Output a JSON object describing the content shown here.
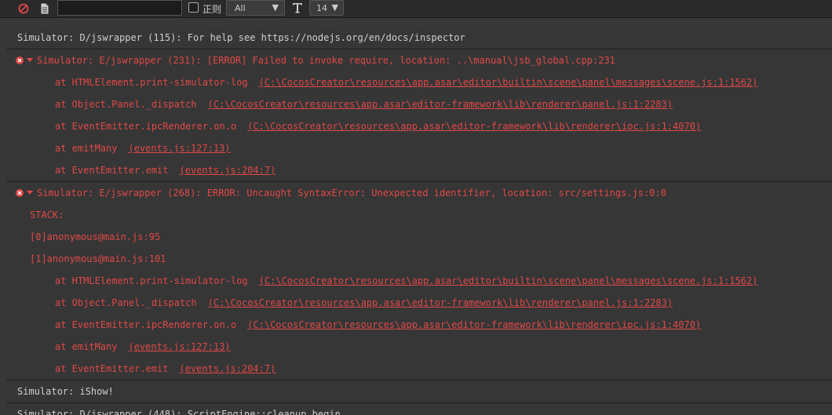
{
  "toolbar": {
    "search_value": "",
    "regex_label": "正则",
    "level_value": "All",
    "font_size_value": "14"
  },
  "colors": {
    "error": "#e04848",
    "text": "#cfcfcf",
    "background": "#383838"
  },
  "log": {
    "entry1": "Simulator: D/jswrapper (115): For help see https://nodejs.org/en/docs/inspector",
    "entry2": {
      "head": "Simulator: E/jswrapper (231): [ERROR] Failed to invoke require, location: ..\\manual\\jsb_global.cpp:231",
      "stack": [
        {
          "fn": "at HTMLElement.print-simulator-log",
          "src": "(C:\\CocosCreator\\resources\\app.asar\\editor\\builtin\\scene\\panel\\messages\\scene.js:1:1562)"
        },
        {
          "fn": "at Object.Panel._dispatch",
          "src": "(C:\\CocosCreator\\resources\\app.asar\\editor-framework\\lib\\renderer\\panel.js:1:2283)"
        },
        {
          "fn": "at EventEmitter.ipcRenderer.on.o",
          "src": "(C:\\CocosCreator\\resources\\app.asar\\editor-framework\\lib\\renderer\\ipc.js:1:4070)"
        },
        {
          "fn": "at emitMany",
          "src": "(events.js:127:13)"
        },
        {
          "fn": "at EventEmitter.emit",
          "src": "(events.js:204:7)"
        }
      ]
    },
    "entry3": {
      "head": "Simulator: E/jswrapper (268): ERROR: Uncaught SyntaxError: Unexpected identifier, location: src/settings.js:0:0",
      "lines": [
        "STACK:",
        "[0]anonymous@main.js:95",
        "[1]anonymous@main.js:101"
      ],
      "stack": [
        {
          "fn": "at HTMLElement.print-simulator-log",
          "src": "(C:\\CocosCreator\\resources\\app.asar\\editor\\builtin\\scene\\panel\\messages\\scene.js:1:1562)"
        },
        {
          "fn": "at Object.Panel._dispatch",
          "src": "(C:\\CocosCreator\\resources\\app.asar\\editor-framework\\lib\\renderer\\panel.js:1:2283)"
        },
        {
          "fn": "at EventEmitter.ipcRenderer.on.o",
          "src": "(C:\\CocosCreator\\resources\\app.asar\\editor-framework\\lib\\renderer\\ipc.js:1:4070)"
        },
        {
          "fn": "at emitMany",
          "src": "(events.js:127:13)"
        },
        {
          "fn": "at EventEmitter.emit",
          "src": "(events.js:204:7)"
        }
      ]
    },
    "entry4": "Simulator: iShow!",
    "entry5": "Simulator: D/jswrapper (448): ScriptEngine::cleanup begin"
  }
}
